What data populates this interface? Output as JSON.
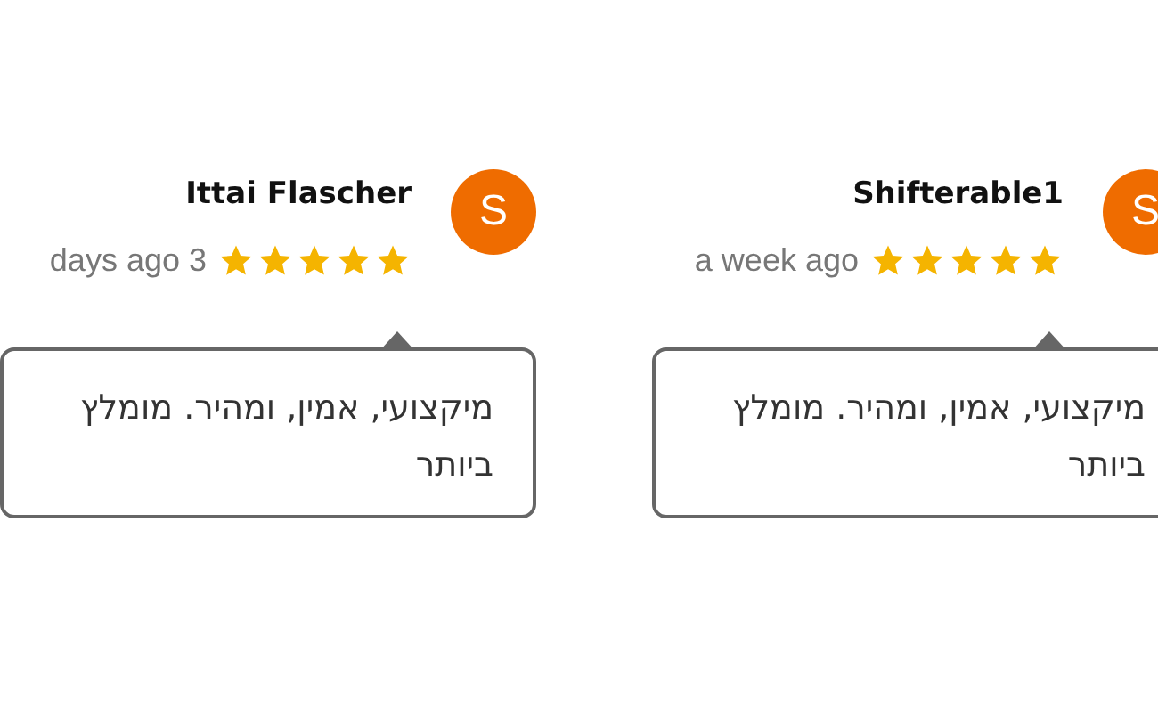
{
  "reviews": [
    {
      "name": "Shifterable1",
      "avatar": "S",
      "time": "a week ago",
      "stars": 5,
      "text": "מיקצועי, אמין, ומהיר. מומלץ ביותר"
    },
    {
      "name": "Ittai Flascher",
      "avatar": "S",
      "time": "days ago 3",
      "stars": 5,
      "text": "מיקצועי, אמין, ומהיר. מומלץ ביותר"
    }
  ]
}
